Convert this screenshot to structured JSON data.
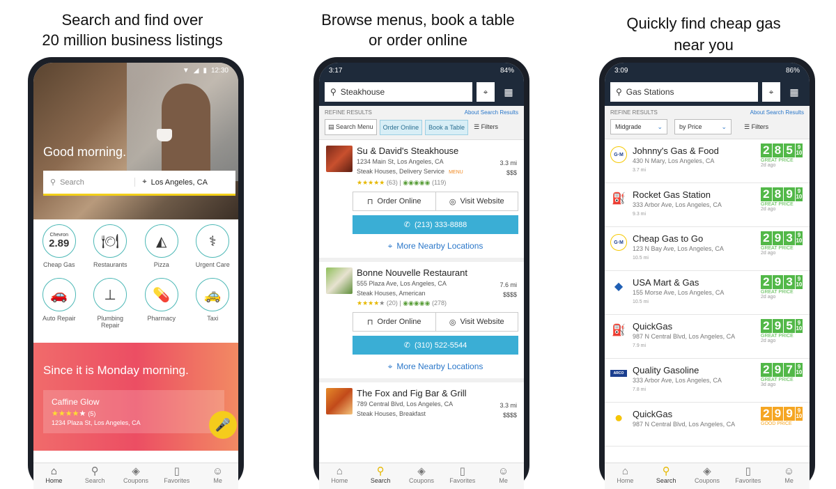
{
  "headlines": {
    "left": [
      "Search and find over",
      "20 million business listings"
    ],
    "center": [
      "Browse menus, book a table",
      "or order online"
    ],
    "right": [
      "Quickly find cheap gas",
      "near you"
    ]
  },
  "tabs": [
    "Home",
    "Search",
    "Coupons",
    "Favorites",
    "Me"
  ],
  "phone1": {
    "time": "12:30",
    "greeting": "Good morning.",
    "search_placeholder": "Search",
    "location": "Los Angeles, CA",
    "categories": [
      {
        "label": "Cheap Gas",
        "brand": "Chevron",
        "price": "2.89",
        "icon": "gas-price-icon"
      },
      {
        "label": "Restaurants",
        "icon": "restaurant-icon"
      },
      {
        "label": "Pizza",
        "icon": "pizza-icon"
      },
      {
        "label": "Urgent Care",
        "icon": "caduceus-icon"
      },
      {
        "label": "Auto Repair",
        "icon": "car-wrench-icon"
      },
      {
        "label": "Plumbing Repair",
        "icon": "plunger-icon"
      },
      {
        "label": "Pharmacy",
        "icon": "pill-icon"
      },
      {
        "label": "Taxi",
        "icon": "taxi-icon"
      }
    ],
    "promo_title": "Since it is Monday morning.",
    "promo_card": {
      "name": "Caffine Glow",
      "stars": 4,
      "count": "(5)",
      "address": "1234 Plaza St, Los Angeles, CA"
    }
  },
  "phone2": {
    "time": "3:17",
    "battery": "84%",
    "query": "Steakhouse",
    "refine_label": "REFINE RESULTS",
    "about_link": "About Search Results",
    "chips": [
      {
        "label": "Search Menu",
        "active": false
      },
      {
        "label": "Order Online",
        "active": true
      },
      {
        "label": "Book a Table",
        "active": true
      }
    ],
    "filters_label": "Filters",
    "listings": [
      {
        "name": "Su & David's Steakhouse",
        "address": "1234 Main St, Los Angeles, CA",
        "categories": "Steak Houses, Delivery Service",
        "menu_tag": "MENU",
        "distance": "3.3 mi",
        "price": "$$$",
        "rating_count": "(63)",
        "ta_count": "(119)",
        "phone": "(213) 333-8888",
        "order_label": "Order Online",
        "website_label": "Visit Website",
        "more_label": "More Nearby Locations"
      },
      {
        "name": "Bonne Nouvelle Restaurant",
        "address": "555 Plaza Ave, Los Angeles, CA",
        "categories": "Steak Houses, American",
        "menu_tag": "",
        "distance": "7.6 mi",
        "price": "$$$$",
        "rating_count": "(20)",
        "ta_count": "(278)",
        "phone": "(310) 522-5544",
        "order_label": "Order Online",
        "website_label": "Visit Website",
        "more_label": "More Nearby Locations"
      },
      {
        "name": "The Fox and Fig Bar & Grill",
        "address": "789 Central Blvd, Los Angeles, CA",
        "categories": "Steak Houses, Breakfast",
        "distance": "3.3 mi",
        "price": "$$$$"
      }
    ]
  },
  "phone3": {
    "time": "3:09",
    "battery": "86%",
    "query": "Gas Stations",
    "refine_label": "REFINE RESULTS",
    "about_link": "About Search Results",
    "grade": "Midgrade",
    "sort": "by Price",
    "filters_label": "Filters",
    "stations": [
      {
        "name": "Johnny's Gas & Food",
        "address": "430 N Mary, Los Angeles, CA",
        "distance": "3.7 mi",
        "price": "2.85",
        "tenths": "9/10",
        "label": "GREAT PRICE",
        "ago": "2d ago",
        "logo": "GM",
        "tone": "green"
      },
      {
        "name": "Rocket Gas Station",
        "address": "333 Arbor Ave, Los Angeles, CA",
        "distance": "9.3 mi",
        "price": "2.89",
        "tenths": "9/10",
        "label": "GREAT PRICE",
        "ago": "2d ago",
        "logo": "pump",
        "tone": "green"
      },
      {
        "name": "Cheap Gas to Go",
        "address": "123 N Bay Ave, Los Angeles, CA",
        "distance": "10.5 mi",
        "price": "2.93",
        "tenths": "9/10",
        "label": "GREAT PRICE",
        "ago": "2d ago",
        "logo": "GM",
        "tone": "green"
      },
      {
        "name": "USA Mart & Gas",
        "address": "155 Morse Ave, Los Angeles, CA",
        "distance": "10.5 mi",
        "price": "2.93",
        "tenths": "9/10",
        "label": "GREAT PRICE",
        "ago": "2d ago",
        "logo": "chevron",
        "tone": "green"
      },
      {
        "name": "QuickGas",
        "address": "987 N Central Blvd, Los Angeles, CA",
        "distance": "7.9 mi",
        "price": "2.95",
        "tenths": "9/10",
        "label": "GREAT PRICE",
        "ago": "2d ago",
        "logo": "pump",
        "tone": "green"
      },
      {
        "name": "Quality Gasoline",
        "address": "333 Arbor Ave, Los Angeles, CA",
        "distance": "7.8 mi",
        "price": "2.97",
        "tenths": "9/10",
        "label": "GREAT PRICE",
        "ago": "3d ago",
        "logo": "arco",
        "tone": "green"
      },
      {
        "name": "QuickGas",
        "address": "987 N Central Blvd, Los Angeles, CA",
        "distance": "",
        "price": "2.99",
        "tenths": "9/10",
        "label": "GOOD PRICE",
        "ago": "",
        "logo": "shell",
        "tone": "orange"
      }
    ]
  },
  "colors": {
    "teal": "#4cb8b6",
    "yellow": "#f2cf1a",
    "navy": "#1e2a3a",
    "blue_btn": "#3aaed5",
    "gas_green": "#52b848",
    "gas_orange": "#f5a623"
  }
}
